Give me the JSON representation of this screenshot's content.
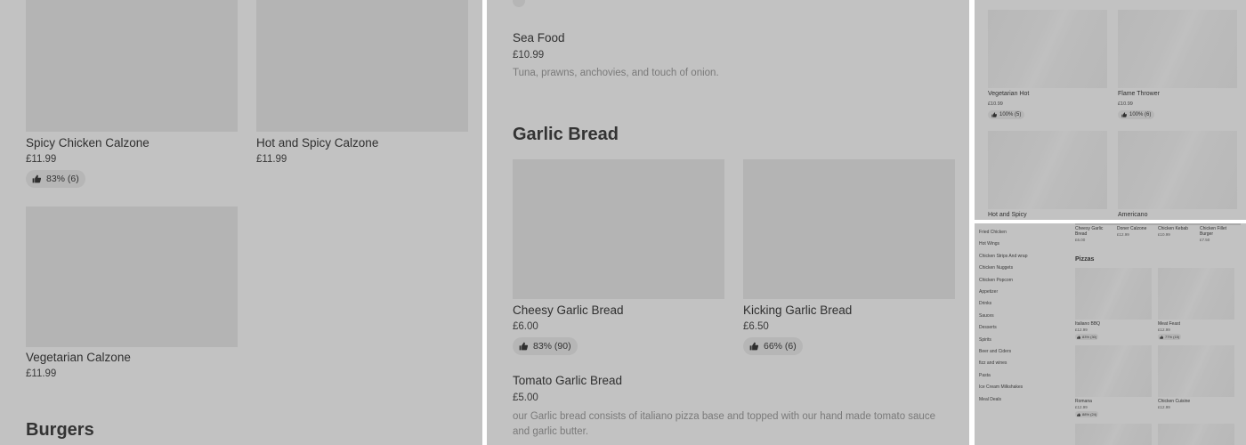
{
  "panel1": {
    "items": [
      {
        "name": "Spicy Chicken Calzone",
        "price": "£11.99",
        "rating": "83% (6)"
      },
      {
        "name": "Hot and Spicy Calzone",
        "price": "£11.99"
      },
      {
        "name": "Vegetarian Calzone",
        "price": "£11.99"
      }
    ],
    "next_section": "Burgers"
  },
  "panel2": {
    "sea_food": {
      "name": "Sea Food",
      "price": "£10.99",
      "description": "Tuna, prawns, anchovies, and touch of onion."
    },
    "section_title": "Garlic Bread",
    "items": [
      {
        "name": "Cheesy Garlic Bread",
        "price": "£6.00",
        "rating": "83% (90)"
      },
      {
        "name": "Kicking Garlic Bread",
        "price": "£6.50",
        "rating": "66% (6)"
      }
    ],
    "tomato": {
      "name": "Tomato Garlic Bread",
      "price": "£5.00",
      "description": "our Garlic bread consists of italiano pizza base and topped with our hand made tomato sauce and garlic butter."
    }
  },
  "panel3": {
    "items": [
      {
        "name": "Vegetarian Hot",
        "price": "£10.99",
        "rating": "100% (5)"
      },
      {
        "name": "Flame Thrower",
        "price": "£10.99",
        "rating": "100% (6)"
      },
      {
        "name": "Hot and Spicy"
      },
      {
        "name": "Americano"
      }
    ]
  },
  "panel4": {
    "categories": [
      "Fried Chicken",
      "Hot Wings",
      "Chicken Strips And wrap",
      "Chicken Nuggets",
      "Chicken Popcorn",
      "Appetizer",
      "Drinks",
      "Sauces",
      "Desserts",
      "Spirits",
      "Beer and Ciders",
      "fizz and wines",
      "Pasta",
      "Ice Cream Milkshakes",
      "Meal Deals"
    ],
    "top_row": [
      {
        "name": "Cheesy Garlic Bread",
        "price": "£6.00"
      },
      {
        "name": "Doner Calzone",
        "price": "£12.99"
      },
      {
        "name": "Chicken Kebab",
        "price": "£10.99"
      },
      {
        "name": "Chicken Fillet Burger",
        "price": "£7.50"
      }
    ],
    "section_title": "Pizzas",
    "pizzas": [
      {
        "name": "Italiano BBQ",
        "price": "£12.99",
        "rating": "83% (30)"
      },
      {
        "name": "Meat Feast",
        "price": "£12.99",
        "rating": "77% (15)"
      },
      {
        "name": "Romana",
        "price": "£12.99",
        "rating": "88% (24)"
      },
      {
        "name": "Chicken Cuisine",
        "price": "£12.99"
      }
    ]
  }
}
